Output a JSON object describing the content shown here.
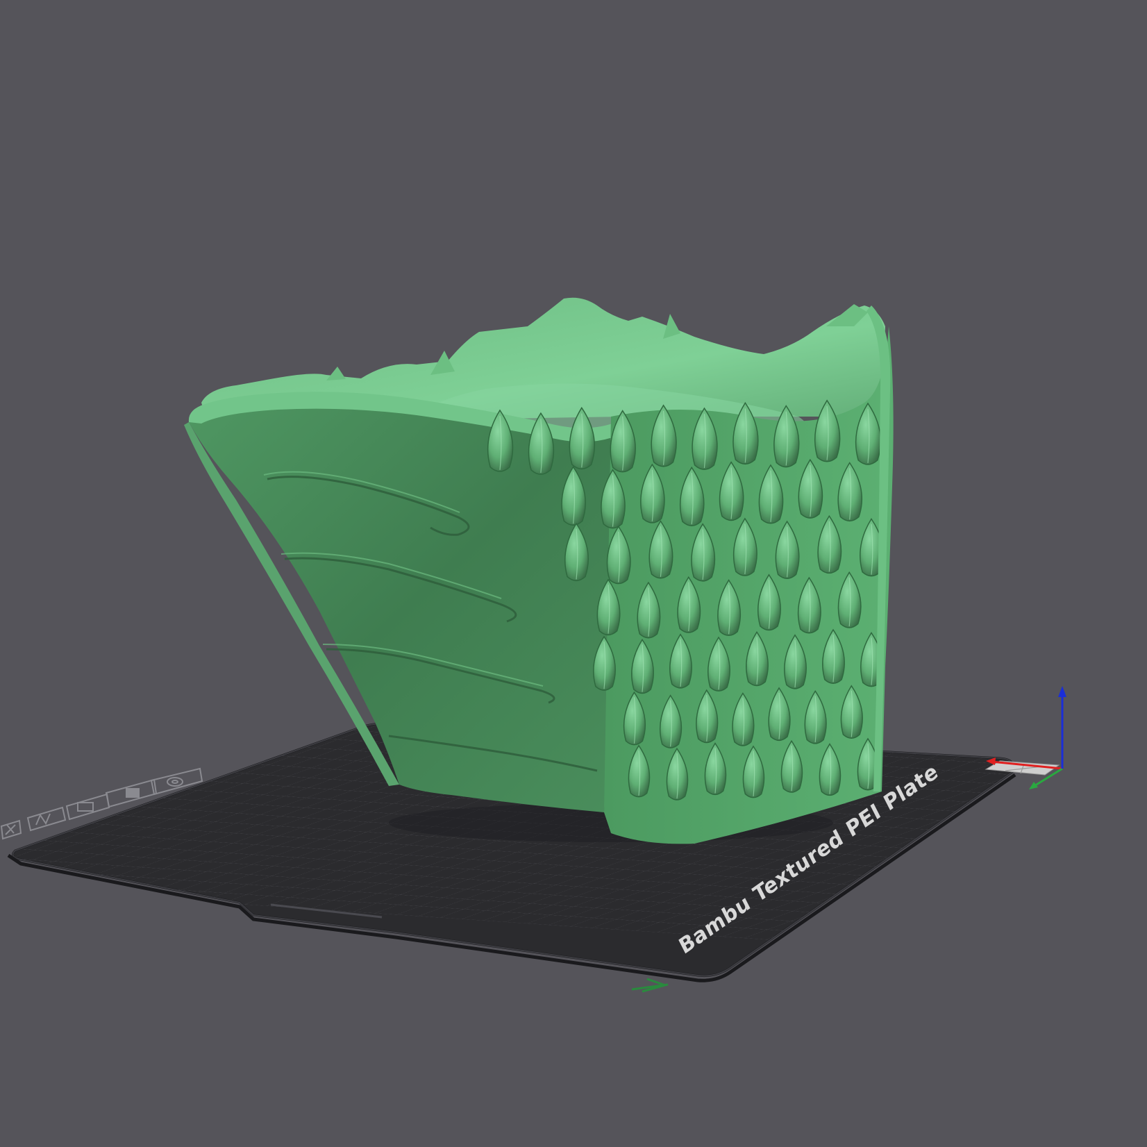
{
  "app": {
    "view": "3d-prepare-viewport"
  },
  "colors": {
    "background": "#55545a",
    "plate": "#2b2b2e",
    "plate_grid": "#47474b",
    "plate_border": "#1f1f22",
    "model_light": "#78c98d",
    "model_mid": "#5aa46d",
    "model_dark": "#3f7a4e",
    "axis_x": "#e02020",
    "axis_y": "#2aa840",
    "axis_z": "#1a2ed8"
  },
  "build_plate": {
    "label": "Bambu Textured PEI Plate"
  },
  "model": {
    "name": "dragon-scale-head-model"
  },
  "plate_toolbar": {
    "icons": [
      "close-icon",
      "auto-arrange-icon",
      "lock-icon",
      "plate-view-icon",
      "settings-icon"
    ]
  },
  "axes": {
    "labels": [
      "X",
      "Y",
      "Z"
    ]
  }
}
